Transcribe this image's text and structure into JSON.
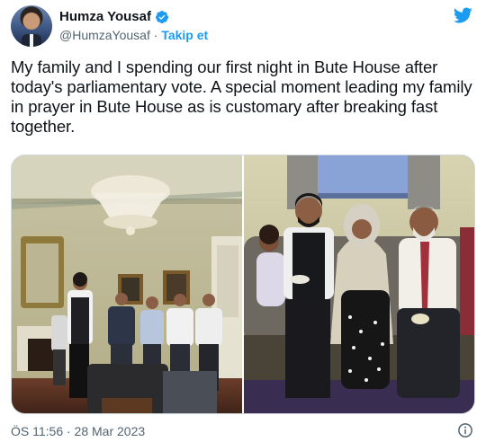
{
  "author": {
    "name": "Humza Yousaf",
    "handle": "@HumzaYousaf",
    "separator": "·",
    "follow_label": "Takip et"
  },
  "tweet": {
    "text": "My family and I spending our first night in Bute House after today's parliamentary vote. A special moment leading my family in prayer in Bute House as is customary after breaking fast together.",
    "timestamp": "ÖS 11:56 · 28 Mar 2023"
  },
  "media": {
    "photo_count": 2
  },
  "icons": {
    "verified": "verified-badge-icon",
    "platform": "twitter-bird-icon",
    "info": "info-icon"
  },
  "colors": {
    "accent": "#1d9bf0",
    "text": "#0f1419",
    "muted": "#536471",
    "border": "#cfd9de"
  }
}
